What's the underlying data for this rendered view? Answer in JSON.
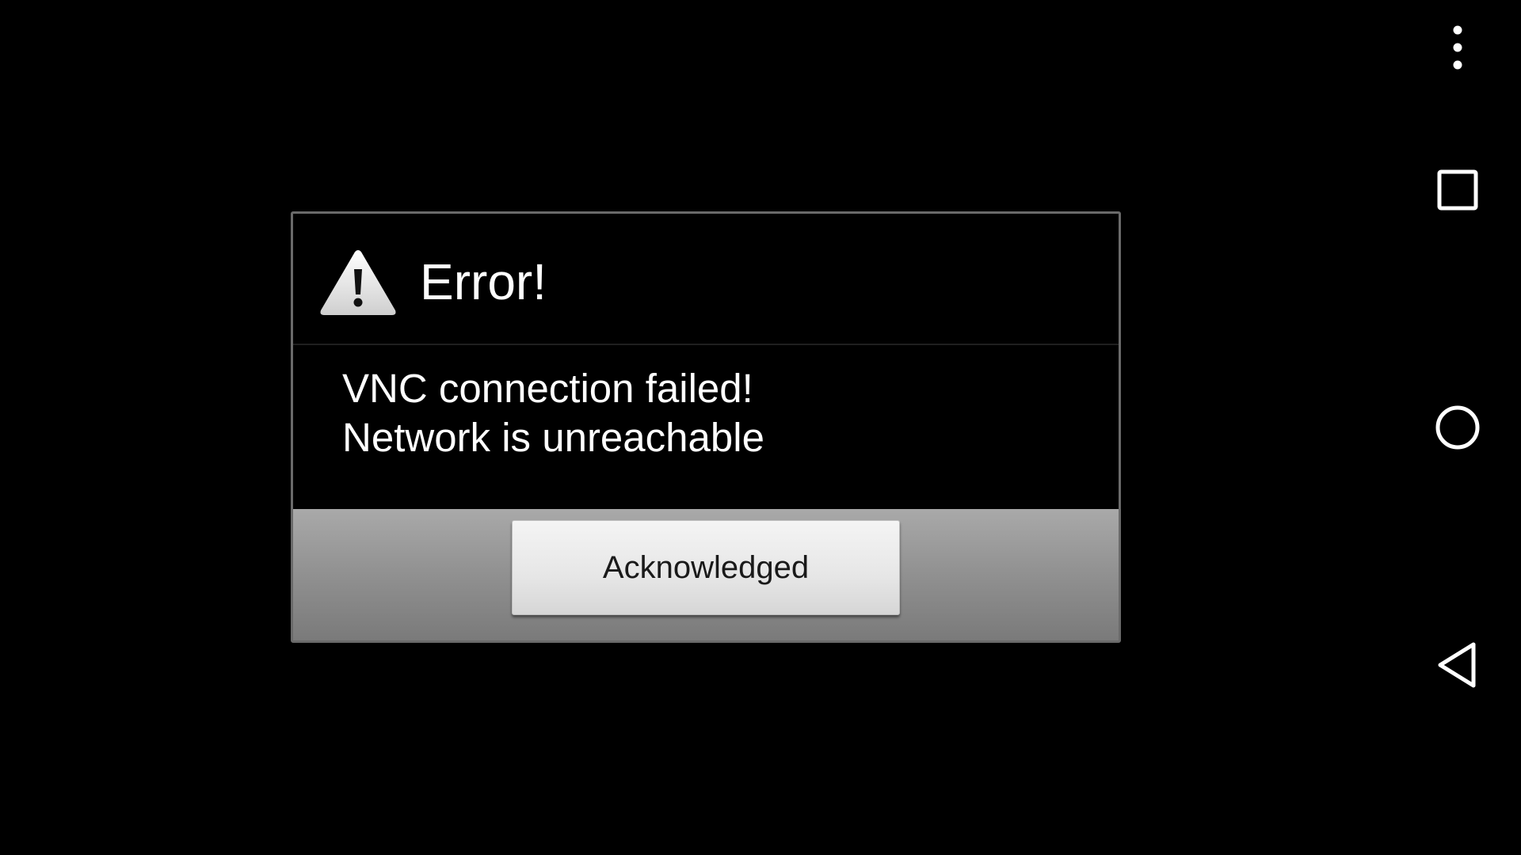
{
  "dialog": {
    "title": "Error!",
    "message_lines": [
      "VNC connection failed!",
      "Network is unreachable"
    ],
    "button_label": "Acknowledged",
    "icon": "warning-triangle-icon"
  },
  "nav_bar": {
    "icons": [
      "overflow-menu-icon",
      "recents-icon",
      "home-icon",
      "back-icon"
    ]
  },
  "colors": {
    "background": "#000000",
    "dialog_border": "#6a6a6a",
    "text": "#ffffff",
    "button_text": "#1a1a1a",
    "actions_bar": "#8e8e8e"
  }
}
